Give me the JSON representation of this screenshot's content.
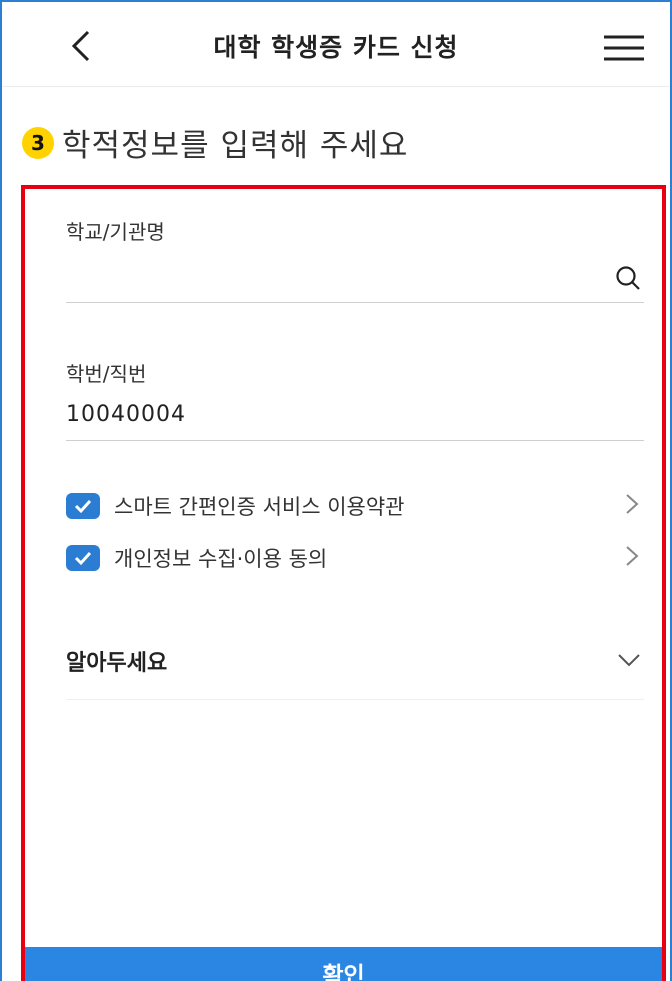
{
  "header": {
    "title": "대학 학생증 카드 신청"
  },
  "step": {
    "number": "3",
    "text": "학적정보를 입력해 주세요"
  },
  "form": {
    "school_label": "학교/기관명",
    "school_value": "",
    "id_label": "학번/직번",
    "id_value": "10040004"
  },
  "agreements": [
    {
      "label": "스마트 간편인증 서비스 이용약관",
      "checked": true
    },
    {
      "label": "개인정보 수집·이용 동의",
      "checked": true
    }
  ],
  "notice": {
    "title": "알아두세요"
  },
  "confirm_button": {
    "label": "확인"
  },
  "colors": {
    "accent": "#2b7cd3",
    "highlight_box": "#e60012",
    "badge": "#ffd200"
  }
}
